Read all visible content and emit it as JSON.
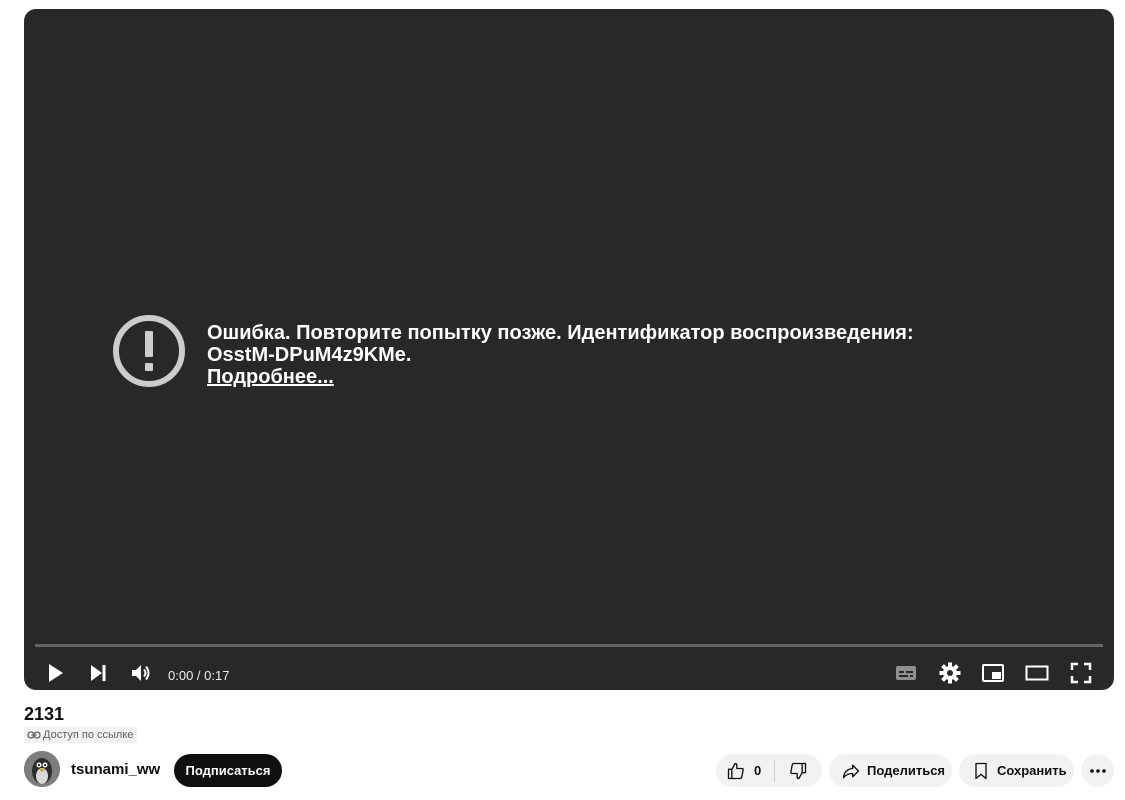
{
  "player": {
    "error_message": "Ошибка. Повторите попытку позже. Идентификатор воспроизведения: OsstM-DPuM4z9KMe.",
    "error_link": "Подробнее...",
    "time": "0:00 / 0:17",
    "icons": [
      "exclamation-circle-icon",
      "play-icon",
      "next-icon",
      "volume-icon",
      "subtitles-icon",
      "settings-icon",
      "miniplayer-icon",
      "theater-mode-icon",
      "fullscreen-icon"
    ],
    "background_color": "#282828"
  },
  "video": {
    "title": "2131",
    "access": "Доступ по ссылке"
  },
  "channel": {
    "name": "tsunami_ww",
    "subscribe_label": "Подписаться"
  },
  "actions": {
    "like_count": "0",
    "share_label": "Поделиться",
    "save_label": "Сохранить"
  }
}
